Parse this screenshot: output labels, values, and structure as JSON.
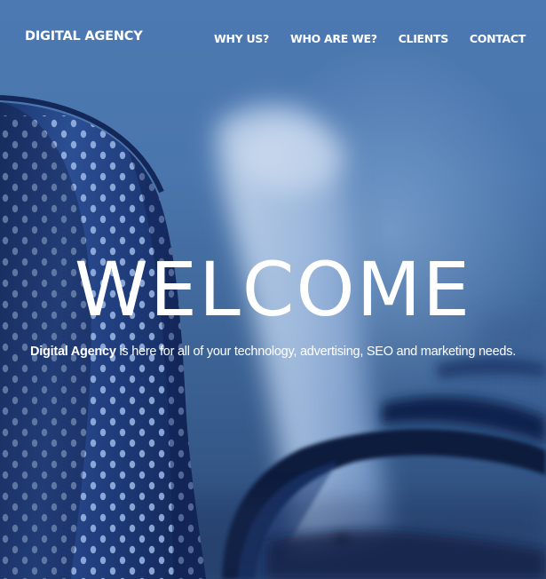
{
  "header": {
    "brand": "DIGITAL AGENCY",
    "nav": [
      {
        "label": "WHY US?"
      },
      {
        "label": "WHO ARE WE?"
      },
      {
        "label": "CLIENTS"
      },
      {
        "label": "CONTACT"
      }
    ]
  },
  "hero": {
    "headline": "WELCOME",
    "tagline_bold": "Digital Agency",
    "tagline_rest": " is here for all of your technology, advertising, SEO and marketing needs.",
    "background_image": "blue-office-chairs-photo"
  },
  "colors": {
    "text": "#ffffff",
    "background": "#4a76ad",
    "chair_dark": "#142a5c"
  }
}
